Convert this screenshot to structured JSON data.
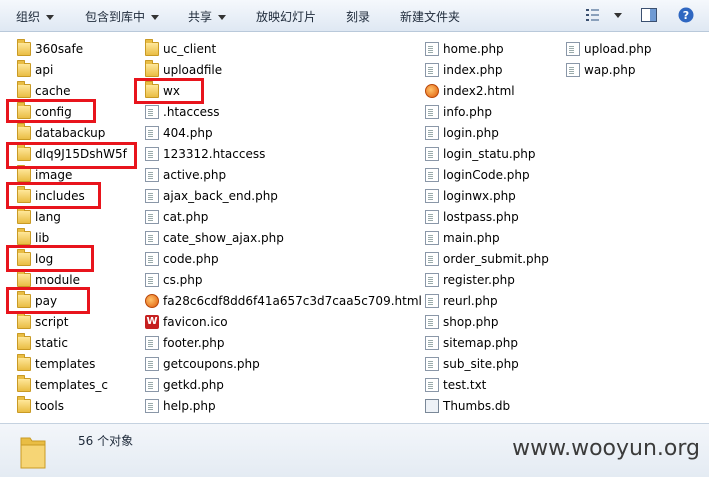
{
  "toolbar": {
    "organize": "组织",
    "include_in_library": "包含到库中",
    "share": "共享",
    "slideshow": "放映幻灯片",
    "burn": "刻录",
    "new_folder": "新建文件夹"
  },
  "files": {
    "col1": [
      "360safe",
      "api",
      "cache",
      "config",
      "databackup",
      "dlq9J15DshW5f",
      "image",
      "includes",
      "lang",
      "lib",
      "log",
      "module",
      "pay",
      "script",
      "static",
      "templates",
      "templates_c",
      "tools"
    ],
    "col2": [
      {
        "name": "uc_client",
        "type": "folder"
      },
      {
        "name": "uploadfile",
        "type": "folder"
      },
      {
        "name": "wx",
        "type": "folder"
      },
      {
        "name": ".htaccess",
        "type": "file"
      },
      {
        "name": "404.php",
        "type": "file"
      },
      {
        "name": "123312.htaccess",
        "type": "file"
      },
      {
        "name": "active.php",
        "type": "file"
      },
      {
        "name": "ajax_back_end.php",
        "type": "file"
      },
      {
        "name": "cat.php",
        "type": "file"
      },
      {
        "name": "cate_show_ajax.php",
        "type": "file"
      },
      {
        "name": "code.php",
        "type": "file"
      },
      {
        "name": "cs.php",
        "type": "file"
      },
      {
        "name": "fa28c6cdf8dd6f41a657c3d7caa5c709.html",
        "type": "html"
      },
      {
        "name": "favicon.ico",
        "type": "ico"
      },
      {
        "name": "footer.php",
        "type": "file"
      },
      {
        "name": "getcoupons.php",
        "type": "file"
      },
      {
        "name": "getkd.php",
        "type": "file"
      },
      {
        "name": "help.php",
        "type": "file"
      }
    ],
    "col3": [
      {
        "name": "home.php",
        "type": "file"
      },
      {
        "name": "index.php",
        "type": "file"
      },
      {
        "name": "index2.html",
        "type": "html"
      },
      {
        "name": "info.php",
        "type": "file"
      },
      {
        "name": "login.php",
        "type": "file"
      },
      {
        "name": "login_statu.php",
        "type": "file"
      },
      {
        "name": "loginCode.php",
        "type": "file"
      },
      {
        "name": "loginwx.php",
        "type": "file"
      },
      {
        "name": "lostpass.php",
        "type": "file"
      },
      {
        "name": "main.php",
        "type": "file"
      },
      {
        "name": "order_submit.php",
        "type": "file"
      },
      {
        "name": "register.php",
        "type": "file"
      },
      {
        "name": "reurl.php",
        "type": "file"
      },
      {
        "name": "shop.php",
        "type": "file"
      },
      {
        "name": "sitemap.php",
        "type": "file"
      },
      {
        "name": "sub_site.php",
        "type": "file"
      },
      {
        "name": "test.txt",
        "type": "file"
      },
      {
        "name": "Thumbs.db",
        "type": "thumbs"
      }
    ],
    "col4": [
      {
        "name": "upload.php",
        "type": "file"
      },
      {
        "name": "wap.php",
        "type": "file"
      }
    ]
  },
  "status": {
    "count": "56 个对象"
  },
  "watermark": "www.wooyun.org",
  "colors": {
    "highlight_box": "#e8141c",
    "folder": "#e9bd44"
  }
}
